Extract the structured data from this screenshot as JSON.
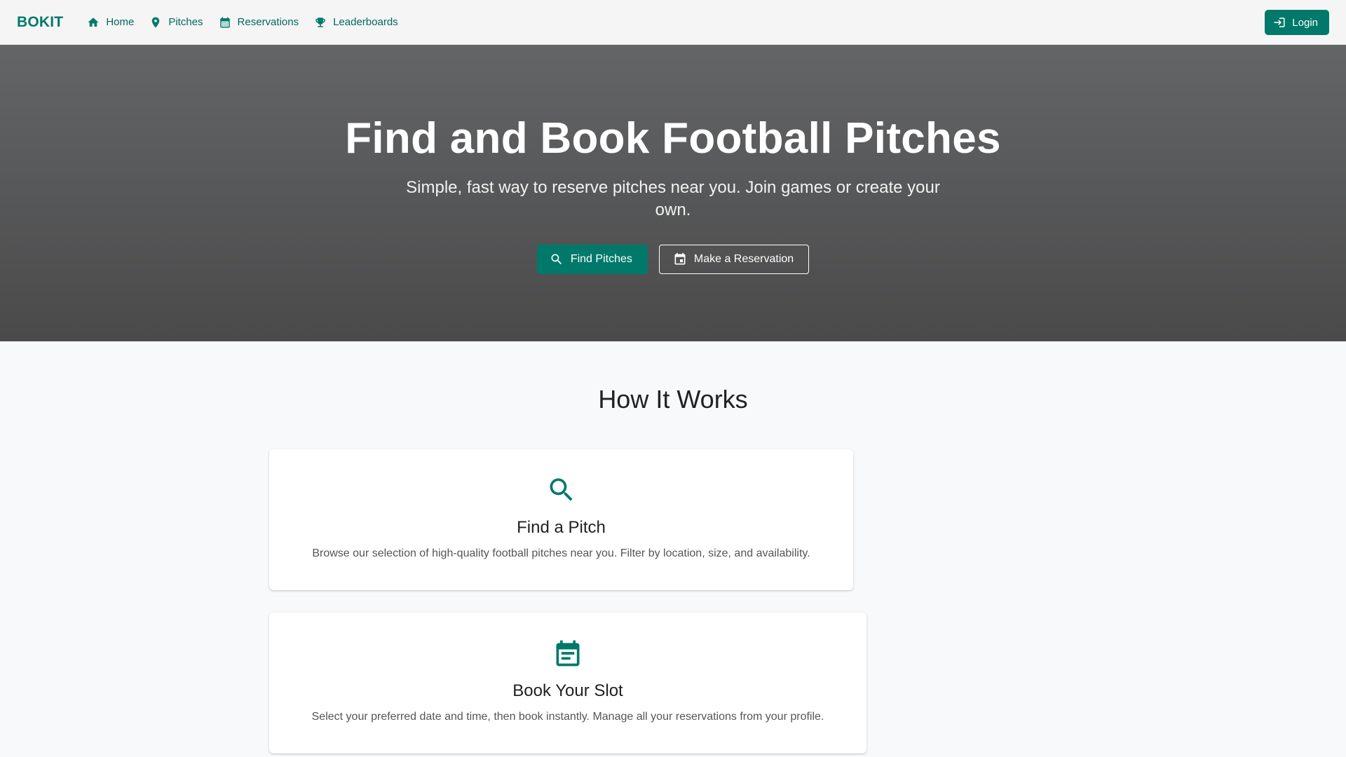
{
  "nav": {
    "brand": "BOKIT",
    "links": [
      {
        "label": "Home",
        "icon": "home-icon"
      },
      {
        "label": "Pitches",
        "icon": "location-pin-icon"
      },
      {
        "label": "Reservations",
        "icon": "calendar-icon"
      },
      {
        "label": "Leaderboards",
        "icon": "trophy-icon"
      }
    ],
    "login_label": "Login"
  },
  "hero": {
    "title": "Find and Book Football Pitches",
    "subtitle": "Simple, fast way to reserve pitches near you. Join games or create your own.",
    "primary_label": "Find Pitches",
    "secondary_label": "Make a Reservation"
  },
  "how_it_works": {
    "title": "How It Works",
    "cards": [
      {
        "icon": "search-icon",
        "title": "Find a Pitch",
        "text": "Browse our selection of high-quality football pitches near you. Filter by location, size, and availability."
      },
      {
        "icon": "calendar-icon",
        "title": "Book Your Slot",
        "text": "Select your preferred date and time, then book instantly. Manage all your reservations from your profile."
      }
    ]
  },
  "colors": {
    "accent": "#00796b",
    "hero_top": "#646566",
    "hero_bottom": "#4a4a4b",
    "page_bg": "#f8f9fa"
  }
}
